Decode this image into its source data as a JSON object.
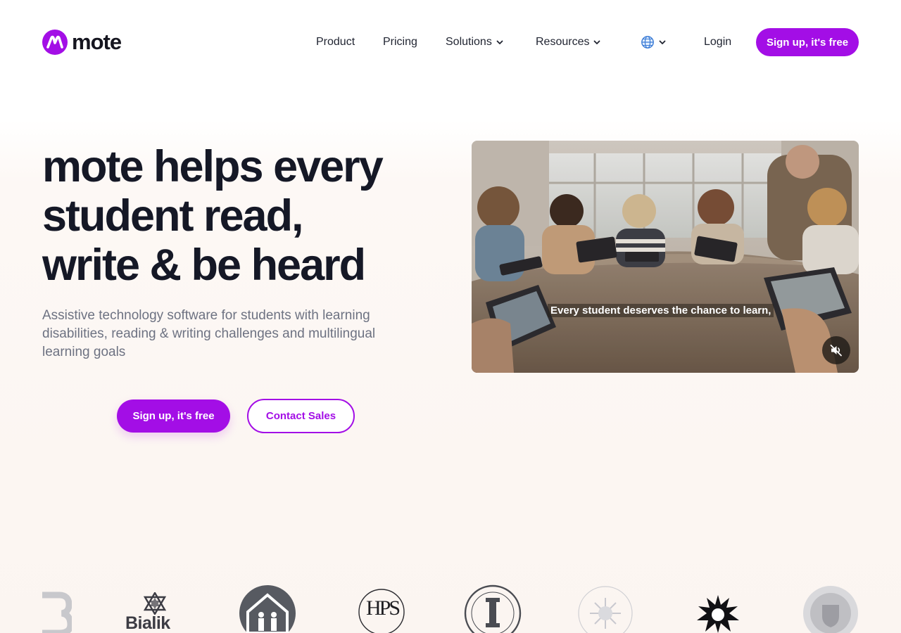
{
  "colors": {
    "accent": "#a30ee6",
    "text_dark": "#151826",
    "text_muted": "#6d7282"
  },
  "header": {
    "logo_text": "mote",
    "nav": {
      "product": "Product",
      "pricing": "Pricing",
      "solutions": "Solutions",
      "resources": "Resources",
      "login": "Login"
    },
    "icons": {
      "language": "globe-icon",
      "dropdown": "chevron-down-icon"
    },
    "signup_label": "Sign up, it's free"
  },
  "hero": {
    "title_lines": [
      "mote helps every",
      "student read,",
      "write & be heard"
    ],
    "subtitle": "Assistive technology software for students with learning disabilities, reading & writing challenges and multilingual learning goals",
    "signup_label": "Sign up, it's free",
    "contact_label": "Contact Sales"
  },
  "video": {
    "caption": "Every student deserves the chance to learn,",
    "mute_icon": "muted-speaker-icon"
  },
  "logos": {
    "bialik_text": "Bialik",
    "hauppauge_text": "HPS"
  }
}
